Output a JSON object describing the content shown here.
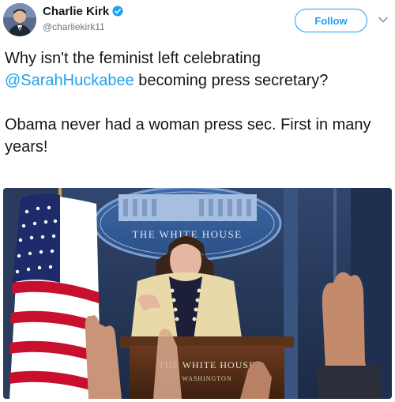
{
  "author": {
    "name": "Charlie Kirk",
    "handle": "@charliekirk11"
  },
  "follow_label": "Follow",
  "tweet": {
    "line1_prefix": "Why isn't the feminist left celebrating",
    "mention": "@SarahHuckabee",
    "line1_suffix": " becoming press secretary?",
    "paragraph2": "Obama never had a woman press sec. First in many years!"
  },
  "photo": {
    "sign_text": "THE WHITE HOUSE",
    "podium_text": "THE WHITE HOUSE",
    "podium_subtext": "WASHINGTON"
  },
  "colors": {
    "accent": "#1da1f2",
    "text": "#14171a",
    "muted": "#657786"
  }
}
